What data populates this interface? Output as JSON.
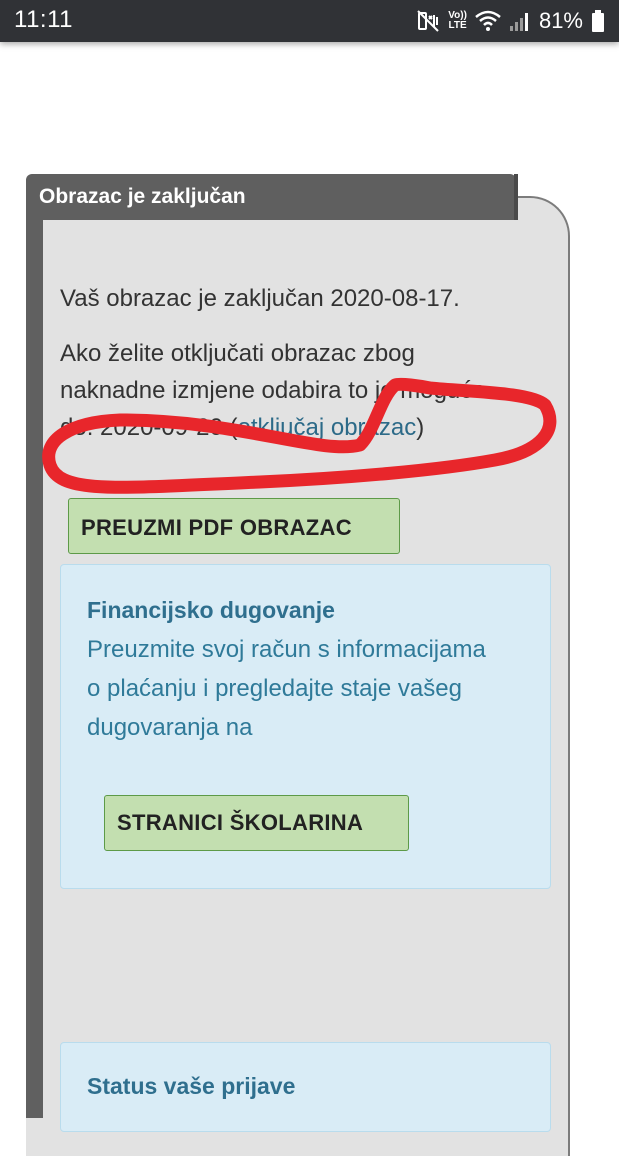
{
  "status_bar": {
    "time": "11:11",
    "battery_percent": "81%",
    "volte_line1": "Vo))",
    "volte_line2": "LTE",
    "icons": [
      "mute-vibrate-icon",
      "volte-icon",
      "wifi-icon",
      "signal-icon",
      "battery-icon"
    ]
  },
  "card": {
    "header_title": "Obrazac je zaključan",
    "locked_text": "Vaš obrazac je zaključan 2020-08-17.",
    "unlock_text_prefix": "Ako želite otključati obrazac zbog naknadne izmjene odabira to je moguće do: 2020-09-20 (",
    "unlock_link": "otključaj obrazac",
    "unlock_text_suffix": ")",
    "download_button": "PREUZMI PDF OBRAZAC"
  },
  "finance_box": {
    "title": "Financijsko dugovanje",
    "text": "Preuzmite svoj račun s informacijama o plaćanju i pregledajte staje vašeg dugovaranja na",
    "button": "STRANICI ŠKOLARINA"
  },
  "status_box": {
    "title": "Status vaše prijave"
  },
  "colors": {
    "status_bar_bg": "#303236",
    "card_header_bg": "#5f5f5f",
    "card_bg": "#e2e2e2",
    "button_green": "#c3dfb0",
    "info_box_bg": "#d9ecf6",
    "link_blue": "#2f6f8e",
    "annotation_red": "#e8262b"
  }
}
